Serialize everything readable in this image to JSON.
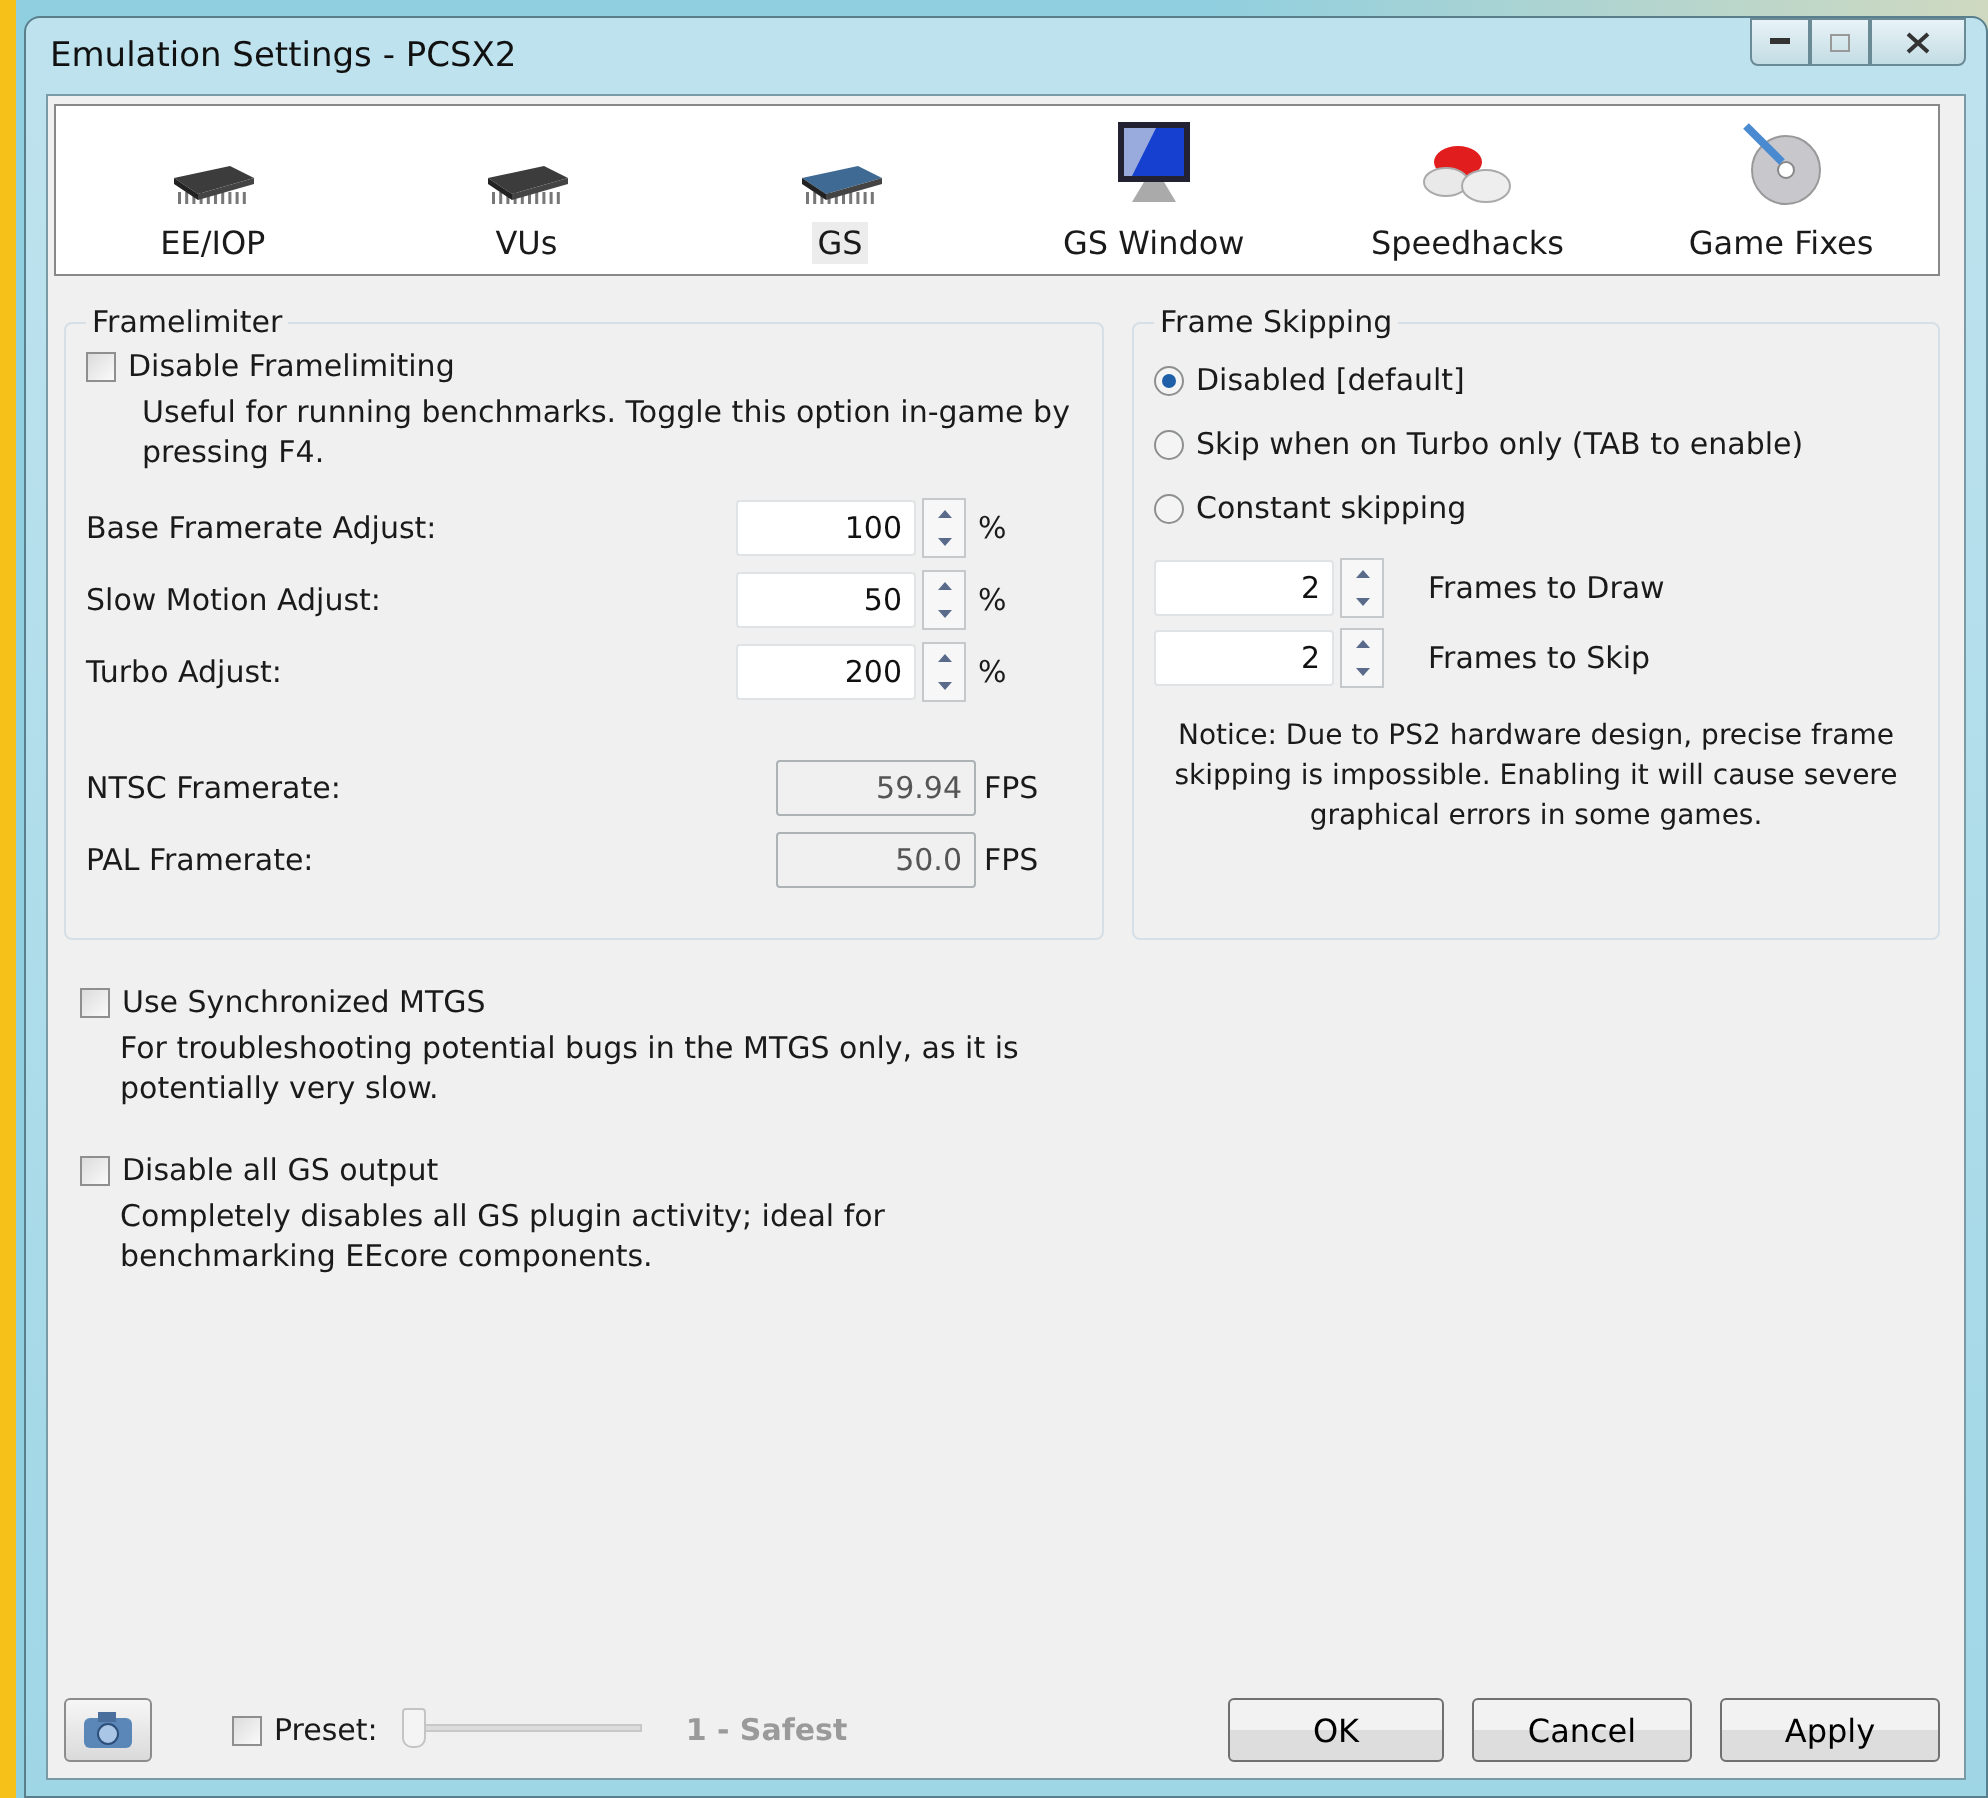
{
  "window": {
    "title": "Emulation Settings - PCSX2"
  },
  "tabs": [
    {
      "label": "EE/IOP",
      "kind": "chip",
      "selected": false
    },
    {
      "label": "VUs",
      "kind": "chip",
      "selected": false
    },
    {
      "label": "GS",
      "kind": "bluechip",
      "selected": true
    },
    {
      "label": "GS Window",
      "kind": "monitor",
      "selected": false
    },
    {
      "label": "Speedhacks",
      "kind": "pills",
      "selected": false
    },
    {
      "label": "Game Fixes",
      "kind": "disc",
      "selected": false
    }
  ],
  "framelimiter": {
    "title": "Framelimiter",
    "disable": {
      "label": "Disable Framelimiting",
      "checked": false,
      "note": "Useful for running benchmarks. Toggle this option in-game by pressing F4."
    },
    "adjust": [
      {
        "label": "Base Framerate Adjust:",
        "value": "100",
        "unit": "%"
      },
      {
        "label": "Slow Motion Adjust:",
        "value": "50",
        "unit": "%"
      },
      {
        "label": "Turbo Adjust:",
        "value": "200",
        "unit": "%"
      }
    ],
    "rates": [
      {
        "label": "NTSC Framerate:",
        "value": "59.94",
        "unit": "FPS"
      },
      {
        "label": "PAL Framerate:",
        "value": "50.0",
        "unit": "FPS"
      }
    ]
  },
  "frame_skipping": {
    "title": "Frame Skipping",
    "options": [
      {
        "label": "Disabled [default]",
        "selected": true
      },
      {
        "label": "Skip when on Turbo only (TAB to enable)",
        "selected": false
      },
      {
        "label": "Constant skipping",
        "selected": false
      }
    ],
    "counts": [
      {
        "value": "2",
        "label": "Frames to Draw"
      },
      {
        "value": "2",
        "label": "Frames to Skip"
      }
    ],
    "notice": "Notice: Due to PS2 hardware design, precise frame skipping is impossible. Enabling it will cause severe graphical errors in some games."
  },
  "options": [
    {
      "label": "Use Synchronized MTGS",
      "checked": false,
      "note": "For troubleshooting potential bugs in the MTGS only, as it is potentially very slow."
    },
    {
      "label": "Disable all GS output",
      "checked": false,
      "note": "Completely disables all GS plugin activity; ideal for benchmarking EEcore components."
    }
  ],
  "footer": {
    "preset": {
      "label": "Preset:",
      "checked": false,
      "level": 0,
      "reading": "1 - Safest",
      "disabled": true
    },
    "buttons": [
      "OK",
      "Cancel",
      "Apply"
    ]
  }
}
